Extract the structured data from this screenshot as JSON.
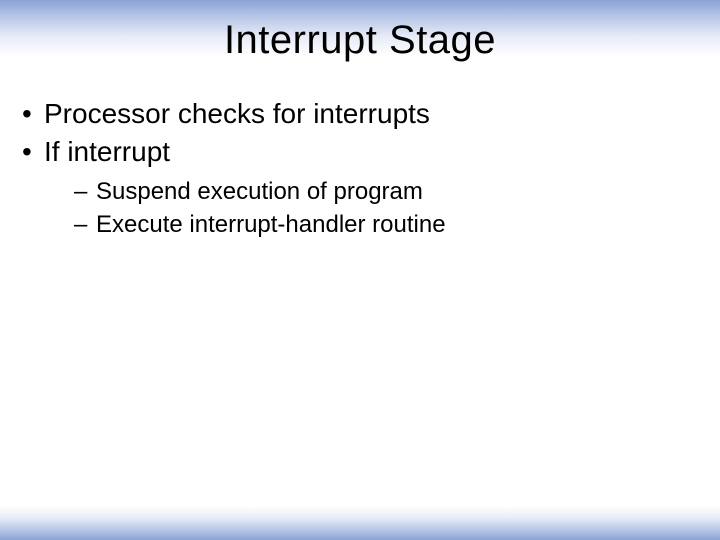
{
  "title": "Interrupt Stage",
  "bullets": {
    "b0": "Processor checks for interrupts",
    "b1": "If interrupt",
    "b1_sub": {
      "s0": "Suspend execution of program",
      "s1": "Execute interrupt-handler routine"
    }
  }
}
